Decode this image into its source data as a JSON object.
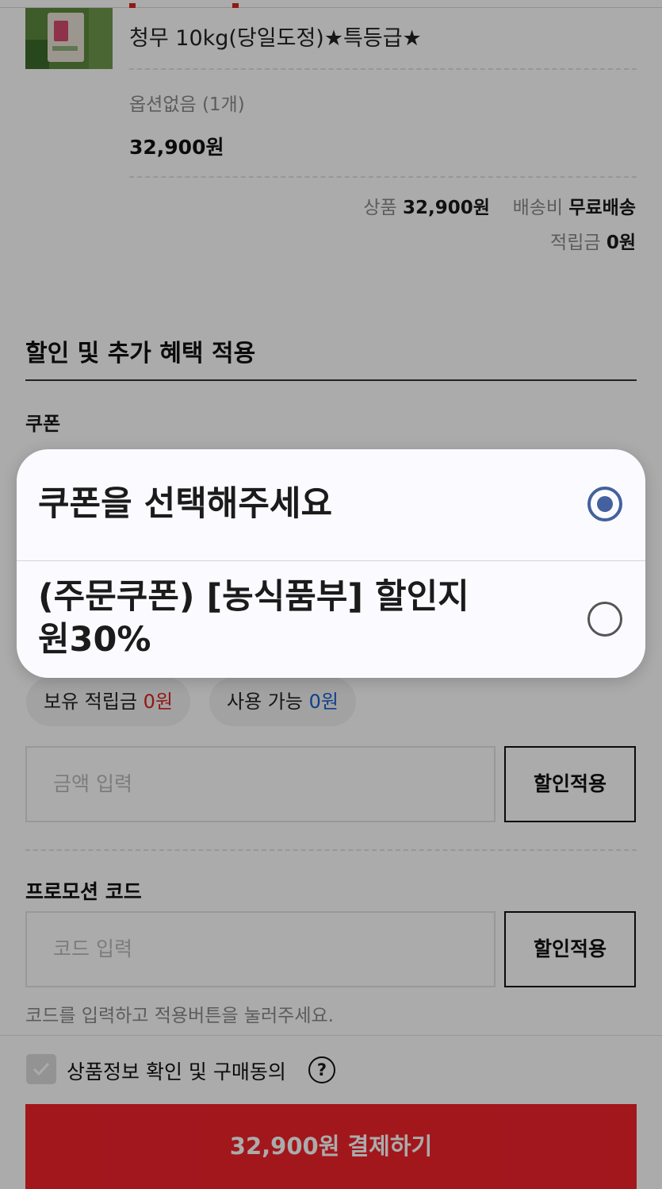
{
  "product": {
    "name": "청무 10kg(당일도정)★특등급★",
    "option": "옵션없음 (1개)",
    "price": "32,900원"
  },
  "summary": {
    "product_label": "상품",
    "product_value": "32,900원",
    "shipping_label": "배송비",
    "shipping_value": "무료배송",
    "points_label": "적립금",
    "points_value": "0원"
  },
  "discount_section": {
    "title": "할인 및 추가 혜택 적용",
    "coupon_label": "쿠폰"
  },
  "points_pills": {
    "owned_label": "보유 적립금",
    "owned_value": "0원",
    "usable_label": "사용 가능",
    "usable_value": "0원"
  },
  "points_input": {
    "placeholder": "금액 입력",
    "button": "할인적용"
  },
  "promo": {
    "label": "프로모션 코드",
    "placeholder": "코드 입력",
    "button": "할인적용",
    "hint": "코드를 입력하고 적용버튼을 눌러주세요."
  },
  "agreement": {
    "label": "상품정보 확인 및 구매동의",
    "help": "?"
  },
  "pay_button": "32,900원 결제하기",
  "coupon_picker": {
    "options": [
      {
        "label": "쿠폰을 선택해주세요",
        "selected": true
      },
      {
        "label": "(주문쿠폰) [농식품부] 할인지원30%",
        "selected": false
      }
    ]
  },
  "colors": {
    "brand_red": "#f2232b",
    "radio_selected": "#44609e",
    "value_red": "#d9251d",
    "value_blue": "#1a5fd0"
  }
}
